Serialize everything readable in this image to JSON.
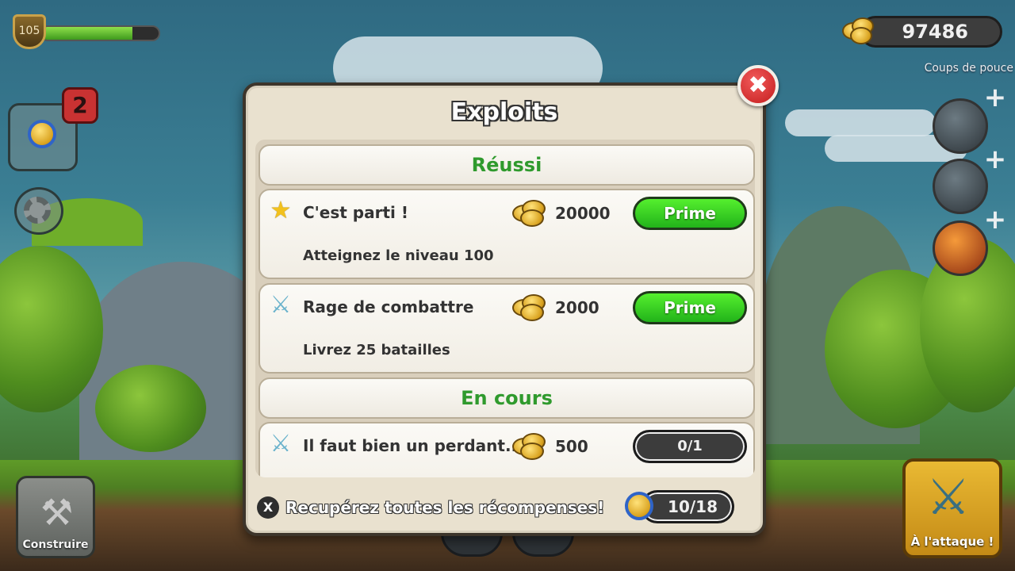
{
  "hud": {
    "player_level": "105",
    "xp_progress": 0.78,
    "coins": "97486",
    "boosts_label": "Coups de pouce",
    "notification_count": "2"
  },
  "buttons": {
    "build_label": "Construire",
    "attack_label": "À l'attaque !"
  },
  "panel": {
    "title": "Exploits",
    "close_glyph": "✖",
    "sections": {
      "completed": "Réussi",
      "in_progress": "En cours"
    },
    "achievements": [
      {
        "title": "C'est parti !",
        "description": "Atteignez le niveau 100",
        "reward": "20000",
        "action_label": "Prime",
        "icon": "star-icon"
      },
      {
        "title": "Rage de combattre",
        "description": "Livrez 25 batailles",
        "reward": "2000",
        "action_label": "Prime",
        "icon": "swords-icon"
      },
      {
        "title": "Il faut bien un perdant...",
        "reward": "500",
        "progress": "0/1",
        "icon": "swords-icon"
      }
    ],
    "footer": {
      "x_glyph": "X",
      "collect_all_text": "Recupérez toutes les récompenses!",
      "total_progress": "10/18"
    }
  },
  "colors": {
    "section_header_text": "#2f9a2d",
    "prime_button": "#3fd22a",
    "close_button": "#d62a2a",
    "attack_button": "#d9a126"
  }
}
